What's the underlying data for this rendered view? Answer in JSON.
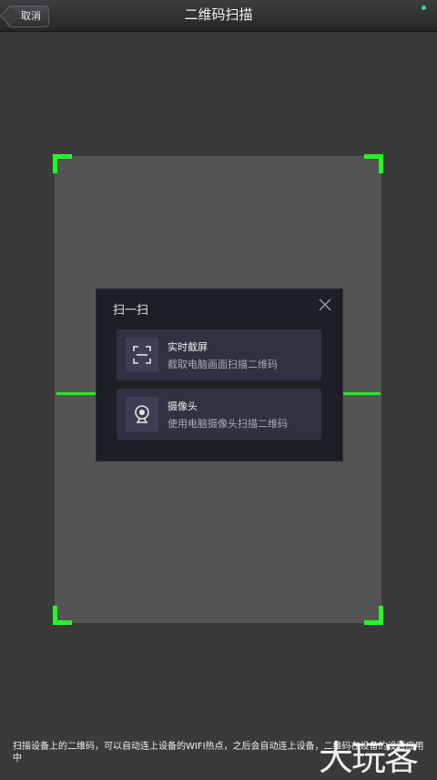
{
  "header": {
    "back_label": "取消",
    "title": "二维码扫描"
  },
  "dialog": {
    "title": "扫一扫",
    "options": [
      {
        "label": "实时截屏",
        "desc": "截取电脑画面扫描二维码",
        "icon": "scan-frame-icon"
      },
      {
        "label": "摄像头",
        "desc": "使用电脑摄像头扫描二维码",
        "icon": "webcam-icon"
      }
    ]
  },
  "footer": {
    "hint": "扫描设备上的二维码，可以自动连上设备的WIFI热点，之后会自动连上设备，二维码在设备的设置应用中"
  },
  "watermark": "大玩客",
  "colors": {
    "scan_green": "#22ff22",
    "status_dot": "#3ddc84"
  }
}
